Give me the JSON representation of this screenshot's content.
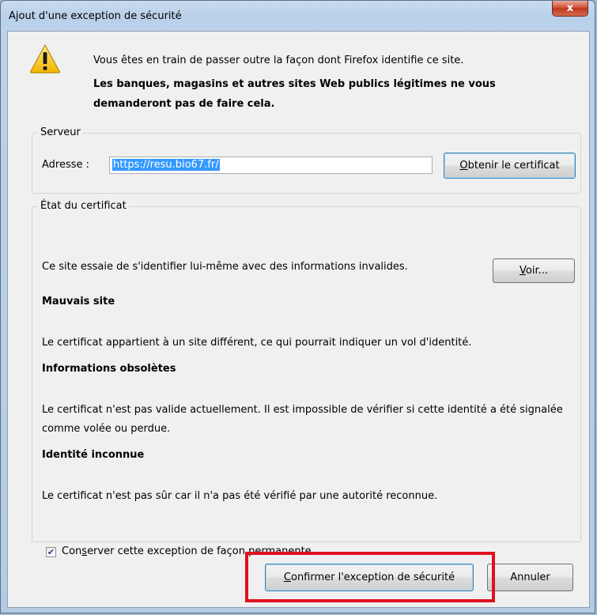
{
  "window": {
    "title": "Ajout d'une exception de sécurité",
    "close_glyph": "x"
  },
  "warning": {
    "icon": "warning-triangle-icon",
    "line1": "Vous êtes en train de passer outre la façon dont Firefox identifie ce site.",
    "line2": "Les banques, magasins et autres sites Web publics légitimes ne vous demanderont pas de faire cela."
  },
  "server": {
    "legend": "Serveur",
    "address_label": "Adresse :",
    "address_value": "https://resu.bio67.fr/",
    "get_cert": {
      "mnemonic": "O",
      "rest": "btenir le certificat"
    }
  },
  "certificate": {
    "legend": "État du certificat",
    "intro": "Ce site essaie de s'identifier lui-même avec des informations invalides.",
    "view_button": {
      "mnemonic": "V",
      "rest": "oir..."
    },
    "sections": [
      {
        "heading": "Mauvais site",
        "text": "Le certificat appartient à un site différent, ce qui pourrait indiquer un vol d'identité."
      },
      {
        "heading": "Informations obsolètes",
        "text": "Le certificat n'est pas valide actuellement. Il est impossible de vérifier si cette identité a été signalée comme volée ou perdue."
      },
      {
        "heading": "Identité inconnue",
        "text": "Le certificat n'est pas sûr car il n'a pas été vérifié par une autorité reconnue."
      }
    ],
    "permanent": {
      "checked": true,
      "label_pre": "Con",
      "mnemonic": "s",
      "label_post": "erver cette exception de façon permanente"
    }
  },
  "buttons": {
    "confirm": {
      "mnemonic": "C",
      "rest": "onfirmer l'exception de sécurité"
    },
    "cancel": "Annuler"
  },
  "colors": {
    "highlight_frame": "#e01020",
    "selection": "#3399ff",
    "close_button": "#c0381f"
  }
}
